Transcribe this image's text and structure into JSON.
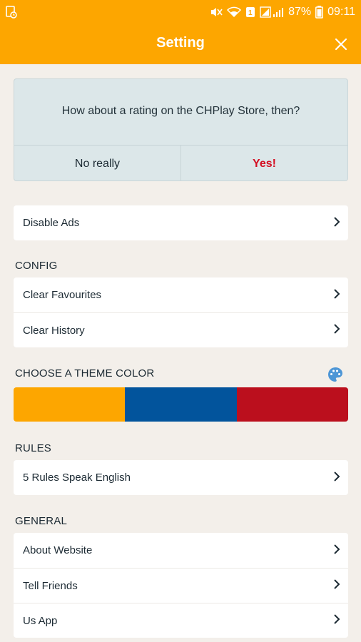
{
  "status_bar": {
    "battery": "87%",
    "time": "09:11",
    "icons": [
      "gallery-sync-icon",
      "mute-icon",
      "wifi-icon",
      "sim-icon",
      "signal-icon",
      "battery-icon"
    ]
  },
  "header": {
    "title": "Setting",
    "close_icon": "close-icon"
  },
  "rating": {
    "question": "How about a rating on the CHPlay Store, then?",
    "no_label": "No really",
    "yes_label": "Yes!"
  },
  "disable_ads": {
    "label": "Disable Ads"
  },
  "config": {
    "heading": "CONFIG",
    "items": [
      {
        "label": "Clear Favourites"
      },
      {
        "label": "Clear History"
      }
    ]
  },
  "theme": {
    "heading": "CHOOSE A THEME COLOR",
    "palette_icon": "palette-icon",
    "colors": [
      "#fda600",
      "#02549c",
      "#bb0f1d"
    ]
  },
  "rules": {
    "heading": "RULES",
    "items": [
      {
        "label": "5 Rules Speak English"
      }
    ]
  },
  "general": {
    "heading": "GENERAL",
    "items": [
      {
        "label": "About Website"
      },
      {
        "label": "Tell Friends"
      },
      {
        "label": "Us App"
      }
    ]
  }
}
